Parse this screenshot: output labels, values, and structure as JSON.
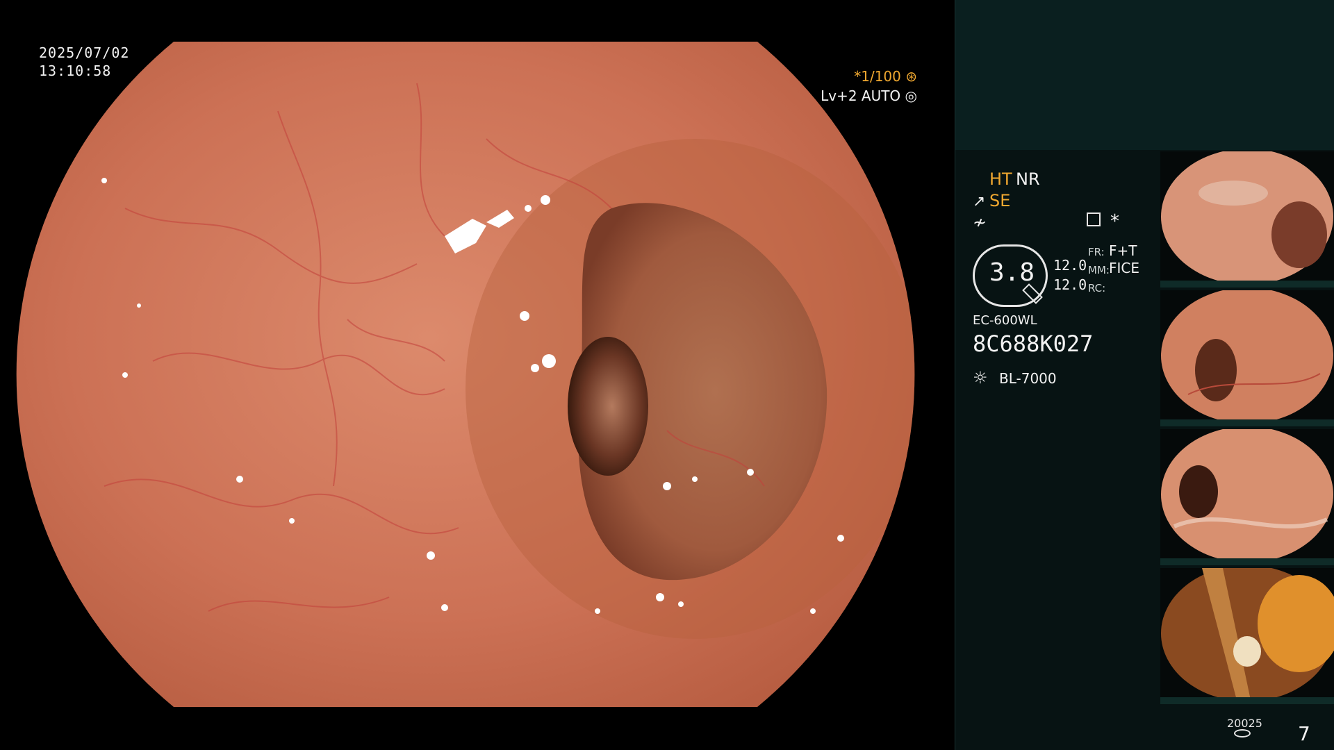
{
  "overlay": {
    "date": "2025/07/02",
    "time": "13:10:58",
    "shutter": "*1/100",
    "level": "Lv+2 AUTO"
  },
  "panel": {
    "ht": "HT",
    "nr": "NR",
    "se": "SE",
    "iris_value": "3.8",
    "gain_top": "12.0",
    "gain_bottom": "12.0",
    "fr_label": "FR:",
    "fr_value": "F+T",
    "mm_label": "MM:",
    "mm_value": "FICE",
    "rc_label": "RC:",
    "scope_model": "EC-600WL",
    "scope_serial": "8C688K027",
    "light_source": "BL-7000",
    "storage_count": "20025",
    "image_count": "7",
    "star": "*"
  },
  "colors": {
    "panel_bg": "#071313",
    "panel_top_bg": "#0a1f1f",
    "accent_orange": "#f0a830",
    "mucosa": "#c86a4e",
    "vessel": "#c2403a"
  }
}
